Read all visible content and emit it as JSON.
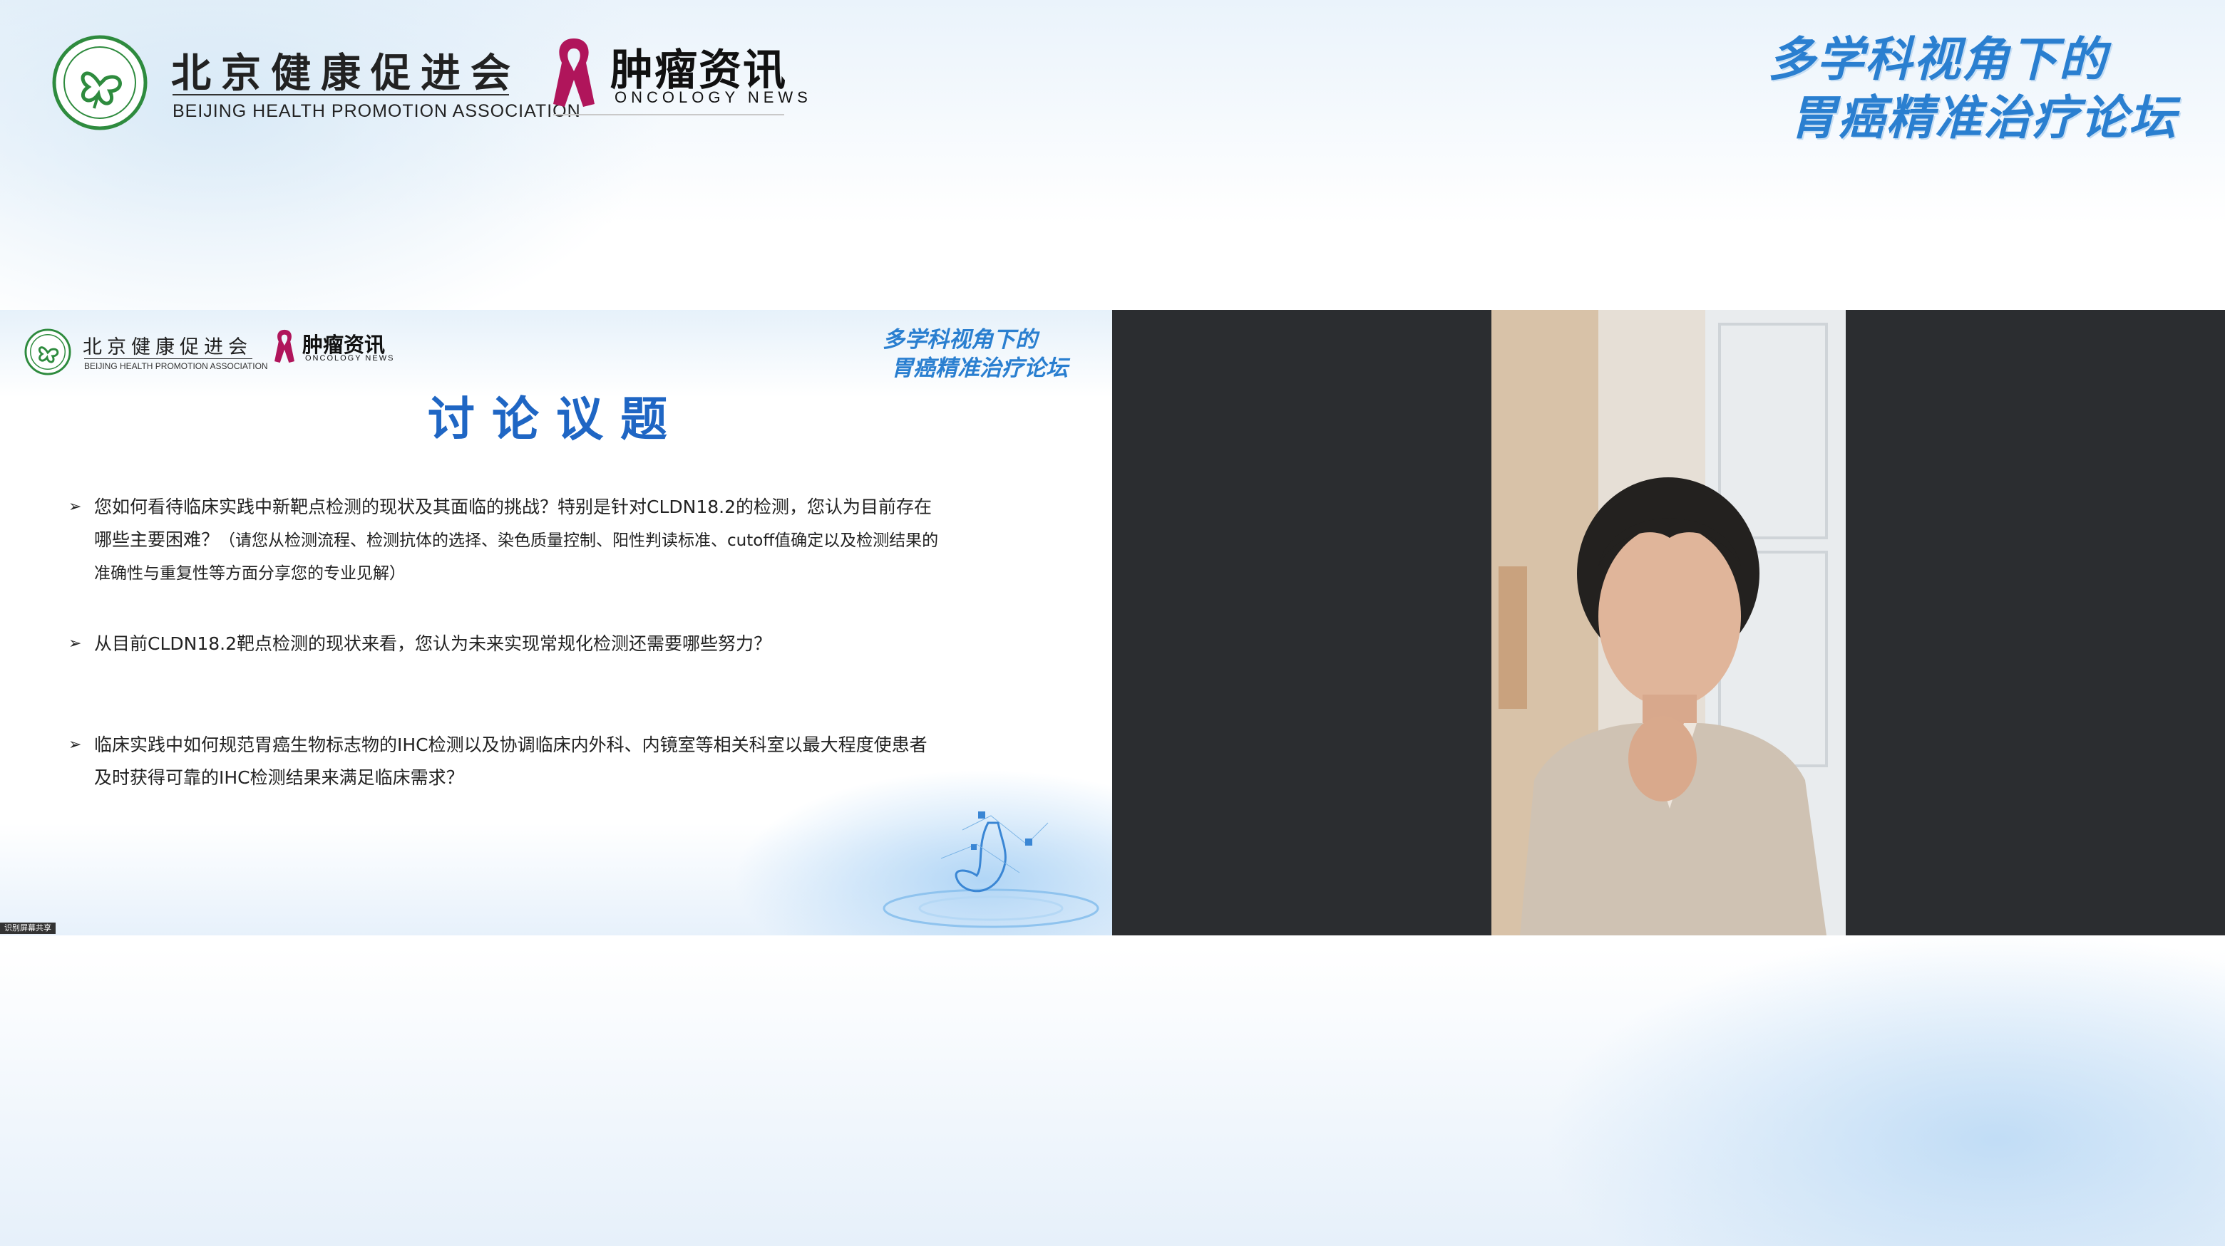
{
  "header": {
    "org_cn": "北京健康促进会",
    "org_en": "BEIJING HEALTH PROMOTION ASSOCIATION",
    "oncology_cn": "肿瘤资讯",
    "oncology_en": "ONCOLOGY NEWS",
    "forum_line1": "多学科视角下的",
    "forum_line2": "胃癌精准治疗论坛"
  },
  "slide": {
    "org_cn": "北京健康促进会",
    "org_en": "BEIJING HEALTH PROMOTION ASSOCIATION",
    "oncology_cn": "肿瘤资讯",
    "oncology_en": "ONCOLOGY NEWS",
    "forum_line1": "多学科视角下的",
    "forum_line2": "胃癌精准治疗论坛",
    "title": "讨论议题",
    "questions": [
      {
        "line1": "您如何看待临床实践中新靶点检测的现状及其面临的挑战？特别是针对CLDN18.2的检测，您认为目前存在",
        "line2": "哪些主要困难？",
        "hint1": "（请您从检测流程、检测抗体的选择、染色质量控制、阳性判读标准、cutoff值确定以及检测结果的",
        "hint2": "准确性与重复性等方面分享您的专业见解）"
      },
      {
        "line1": "从目前CLDN18.2靶点检测的现状来看，您认为未来实现常规化检测还需要哪些努力？"
      },
      {
        "line1": "临床实践中如何规范胃癌生物标志物的IHC检测以及协调临床内外科、内镜室等相关科室以最大程度使患者",
        "line2": "及时获得可靠的IHC检测结果来满足临床需求？"
      }
    ],
    "bullet_glyph": "➢",
    "badge": "识别屏幕共享"
  },
  "colors": {
    "accent": "#1f66c4",
    "forum": "#2a7fd0",
    "ribbon": "#b0155b",
    "video_bg": "#2b2d30"
  }
}
